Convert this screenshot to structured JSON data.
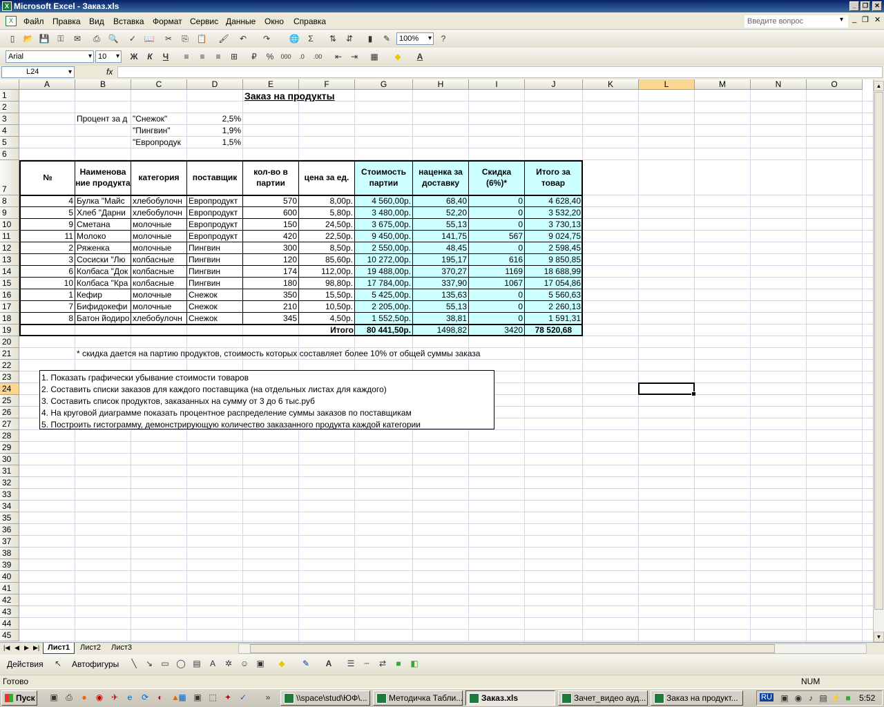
{
  "window": {
    "title": "Microsoft Excel - Заказ.xls"
  },
  "menu": {
    "items": [
      "Файл",
      "Правка",
      "Вид",
      "Вставка",
      "Формат",
      "Сервис",
      "Данные",
      "Окно",
      "Справка"
    ],
    "ask_placeholder": "Введите вопрос"
  },
  "toolbar": {
    "zoom": "100%",
    "font": "Arial",
    "size": "10",
    "bold": "Ж",
    "italic": "К",
    "underline": "Ч"
  },
  "formula_bar": {
    "name_box": "L24",
    "fx": "fx",
    "content": ""
  },
  "columns": [
    "A",
    "B",
    "C",
    "D",
    "E",
    "F",
    "G",
    "H",
    "I",
    "J",
    "K",
    "L",
    "M",
    "N",
    "O"
  ],
  "rows": [
    "1",
    "2",
    "3",
    "4",
    "5",
    "6",
    "7",
    "8",
    "9",
    "10",
    "11",
    "12",
    "13",
    "14",
    "15",
    "16",
    "17",
    "18",
    "19",
    "20",
    "21",
    "22",
    "23",
    "24",
    "25",
    "26",
    "27",
    "28",
    "29",
    "30",
    "31",
    "32",
    "33",
    "34",
    "35",
    "36",
    "37",
    "38",
    "39",
    "40",
    "41",
    "42",
    "43",
    "44",
    "45"
  ],
  "sheet": {
    "title": "Заказ на продукты",
    "percent_label": "Процент за д",
    "suppliers": [
      {
        "name": "\"Снежок\"",
        "pct": "2,5%"
      },
      {
        "name": "\"Пингвин\"",
        "pct": "1,9%"
      },
      {
        "name": "\"Европродук",
        "pct": "1,5%"
      }
    ],
    "headers": {
      "num": "№",
      "name": "Наименова ние продукта",
      "category": "категория",
      "supplier": "поставщик",
      "qty": "кол-во в партии",
      "price": "цена за ед.",
      "cost": "Стоимость партии",
      "markup": "наценка за доставку",
      "discount": "Скидка (6%)*",
      "total": "Итого за товар"
    },
    "data": [
      [
        "4",
        "Булка \"Майс",
        "хлебобулочн",
        "Европродукт",
        "570",
        "8,00р.",
        "4 560,00р.",
        "68,40",
        "0",
        "4 628,40"
      ],
      [
        "5",
        "Хлеб \"Дарни",
        "хлебобулочн",
        "Европродукт",
        "600",
        "5,80р.",
        "3 480,00р.",
        "52,20",
        "0",
        "3 532,20"
      ],
      [
        "9",
        "Сметана",
        "молочные",
        "Европродукт",
        "150",
        "24,50р.",
        "3 675,00р.",
        "55,13",
        "0",
        "3 730,13"
      ],
      [
        "11",
        "Молоко",
        "молочные",
        "Европродукт",
        "420",
        "22,50р.",
        "9 450,00р.",
        "141,75",
        "567",
        "9 024,75"
      ],
      [
        "2",
        "Ряженка",
        "молочные",
        "Пингвин",
        "300",
        "8,50р.",
        "2 550,00р.",
        "48,45",
        "0",
        "2 598,45"
      ],
      [
        "3",
        "Сосиски \"Лю",
        "колбасные",
        "Пингвин",
        "120",
        "85,60р.",
        "10 272,00р.",
        "195,17",
        "616",
        "9 850,85"
      ],
      [
        "6",
        "Колбаса \"Док",
        "колбасные",
        "Пингвин",
        "174",
        "112,00р.",
        "19 488,00р.",
        "370,27",
        "1169",
        "18 688,99"
      ],
      [
        "10",
        "Колбаса \"Кра",
        "колбасные",
        "Пингвин",
        "180",
        "98,80р.",
        "17 784,00р.",
        "337,90",
        "1067",
        "17 054,86"
      ],
      [
        "1",
        "Кефир",
        "молочные",
        "Снежок",
        "350",
        "15,50р.",
        "5 425,00р.",
        "135,63",
        "0",
        "5 560,63"
      ],
      [
        "7",
        "Бифидокефи",
        "молочные",
        "Снежок",
        "210",
        "10,50р.",
        "2 205,00р.",
        "55,13",
        "0",
        "2 260,13"
      ],
      [
        "8",
        "Батон йодиро",
        "хлебобулочн",
        "Снежок",
        "345",
        "4,50р.",
        "1 552,50р.",
        "38,81",
        "0",
        "1 591,31"
      ]
    ],
    "totals": {
      "label": "Итого",
      "cost": "80 441,50р.",
      "markup": "1498,82",
      "discount": "3420",
      "total": "78 520,68"
    },
    "note": "* скидка дается на партию продуктов, стоимость которых составляет более 10% от общей суммы заказа",
    "tasks": [
      "1. Показать графически убывание стоимости товаров",
      "2. Составить списки заказов для каждого поставщика (на отдельных листах для каждого)",
      "3. Составить список продуктов, заказанных на сумму от 3 до 6 тыс.руб",
      "4. На круговой диаграмме показать процентное распределение суммы заказов по поставщикам",
      "5. Построить гистограмму, демонстрирующую количество заказанного продукта каждой категории"
    ]
  },
  "sheet_tabs": [
    "Лист1",
    "Лист2",
    "Лист3"
  ],
  "drawing": {
    "actions": "Действия",
    "autoshapes": "Автофигуры"
  },
  "status": {
    "ready": "Готово",
    "num": "NUM"
  },
  "taskbar": {
    "start": "Пуск",
    "tasks": [
      "\\\\space\\stud\\ЮФ\\...",
      "Методичка Табли...",
      "Заказ.xls",
      "Зачет_видео ауд...",
      "Заказ на продукт..."
    ],
    "lang": "RU",
    "clock": "5:52"
  },
  "colors": {
    "cyan_fill": "#ccffff",
    "selected_col": "#fbd690",
    "titlebar": "#0a246a"
  }
}
